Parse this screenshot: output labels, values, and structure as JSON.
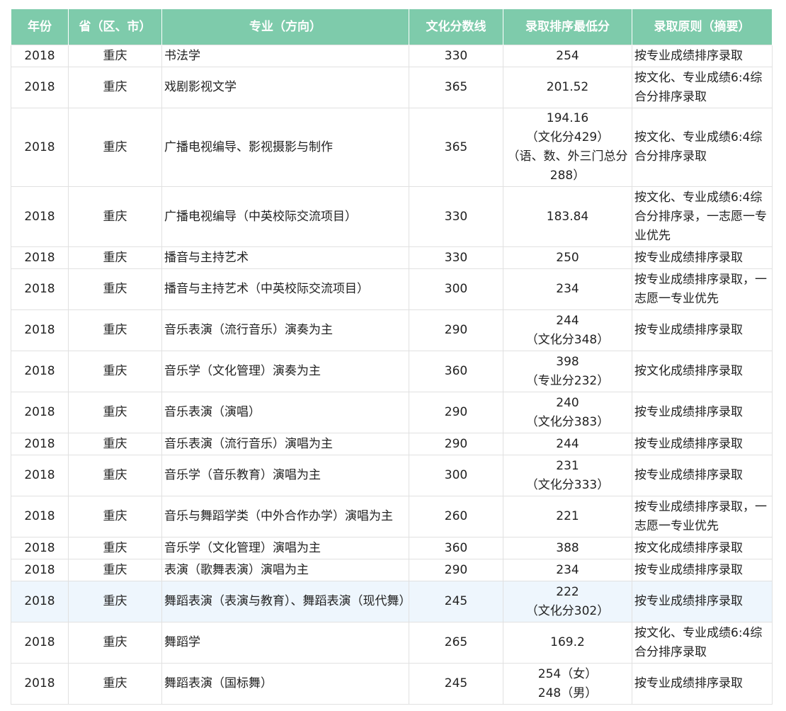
{
  "table": {
    "headers": [
      "年份",
      "省（区、市）",
      "专业（方向）",
      "文化分数线",
      "录取排序最低分",
      "录取原则（摘要）"
    ],
    "rows": [
      {
        "year": "2018",
        "province": "重庆",
        "major": "书法学",
        "culture": "330",
        "min_score": [
          "254"
        ],
        "principle": "按专业成绩排序录取"
      },
      {
        "year": "2018",
        "province": "重庆",
        "major": "戏剧影视文学",
        "culture": "365",
        "min_score": [
          "201.52"
        ],
        "principle": "按文化、专业成绩6:4综合分排序录取"
      },
      {
        "year": "2018",
        "province": "重庆",
        "major": "广播电视编导、影视摄影与制作",
        "culture": "365",
        "min_score": [
          "194.16",
          "（文化分429）",
          "（语、数、外三门总分",
          "288）"
        ],
        "principle": "按文化、专业成绩6:4综合分排序录取"
      },
      {
        "year": "2018",
        "province": "重庆",
        "major": "广播电视编导（中英校际交流项目）",
        "culture": "330",
        "min_score": [
          "183.84"
        ],
        "principle": "按文化、专业成绩6:4综合分排序录，一志愿一专业优先"
      },
      {
        "year": "2018",
        "province": "重庆",
        "major": "播音与主持艺术",
        "culture": "330",
        "min_score": [
          "250"
        ],
        "principle": "按专业成绩排序录取"
      },
      {
        "year": "2018",
        "province": "重庆",
        "major": "播音与主持艺术（中英校际交流项目）",
        "culture": "300",
        "min_score": [
          "234"
        ],
        "principle": "按专业成绩排序录取，一志愿一专业优先"
      },
      {
        "year": "2018",
        "province": "重庆",
        "major": "音乐表演（流行音乐）演奏为主",
        "culture": "290",
        "min_score": [
          "244",
          "（文化分348）"
        ],
        "principle": "按专业成绩排序录取"
      },
      {
        "year": "2018",
        "province": "重庆",
        "major": "音乐学（文化管理）演奏为主",
        "culture": "360",
        "min_score": [
          "398",
          "（专业分232）"
        ],
        "principle": "按文化成绩排序录取"
      },
      {
        "year": "2018",
        "province": "重庆",
        "major": "音乐表演（演唱）",
        "culture": "290",
        "min_score": [
          "240",
          "（文化分383）"
        ],
        "principle": "按专业成绩排序录取"
      },
      {
        "year": "2018",
        "province": "重庆",
        "major": "音乐表演（流行音乐）演唱为主",
        "culture": "290",
        "min_score": [
          "244"
        ],
        "principle": "按专业成绩排序录取"
      },
      {
        "year": "2018",
        "province": "重庆",
        "major": "音乐学（音乐教育）演唱为主",
        "culture": "300",
        "min_score": [
          "231",
          "（文化分333）"
        ],
        "principle": "按专业成绩排序录取"
      },
      {
        "year": "2018",
        "province": "重庆",
        "major": "音乐与舞蹈学类（中外合作办学）演唱为主",
        "culture": "260",
        "min_score": [
          "221"
        ],
        "principle": "按专业成绩排序录取，一志愿一专业优先"
      },
      {
        "year": "2018",
        "province": "重庆",
        "major": "音乐学（文化管理）演唱为主",
        "culture": "360",
        "min_score": [
          "388"
        ],
        "principle": "按文化成绩排序录取"
      },
      {
        "year": "2018",
        "province": "重庆",
        "major": "表演（歌舞表演）演唱为主",
        "culture": "290",
        "min_score": [
          "234"
        ],
        "principle": "按专业成绩排序录取"
      },
      {
        "year": "2018",
        "province": "重庆",
        "major": "舞蹈表演（表演与教育）、舞蹈表演（现代舞）",
        "culture": "245",
        "min_score": [
          "222",
          "（文化分302）"
        ],
        "principle": "按专业成绩排序录取",
        "highlight": true
      },
      {
        "year": "2018",
        "province": "重庆",
        "major": "舞蹈学",
        "culture": "265",
        "min_score": [
          "169.2"
        ],
        "principle": "按文化、专业成绩6:4综合分排序录取"
      },
      {
        "year": "2018",
        "province": "重庆",
        "major": "舞蹈表演（国标舞）",
        "culture": "245",
        "min_score": [
          "254（女）",
          "248（男）"
        ],
        "principle": "按专业成绩排序录取"
      }
    ]
  },
  "colors": {
    "header_bg": "#7ecbab",
    "header_text": "#ffffff",
    "border": "#e1e1e1",
    "highlight_row": "#eef6fd"
  }
}
